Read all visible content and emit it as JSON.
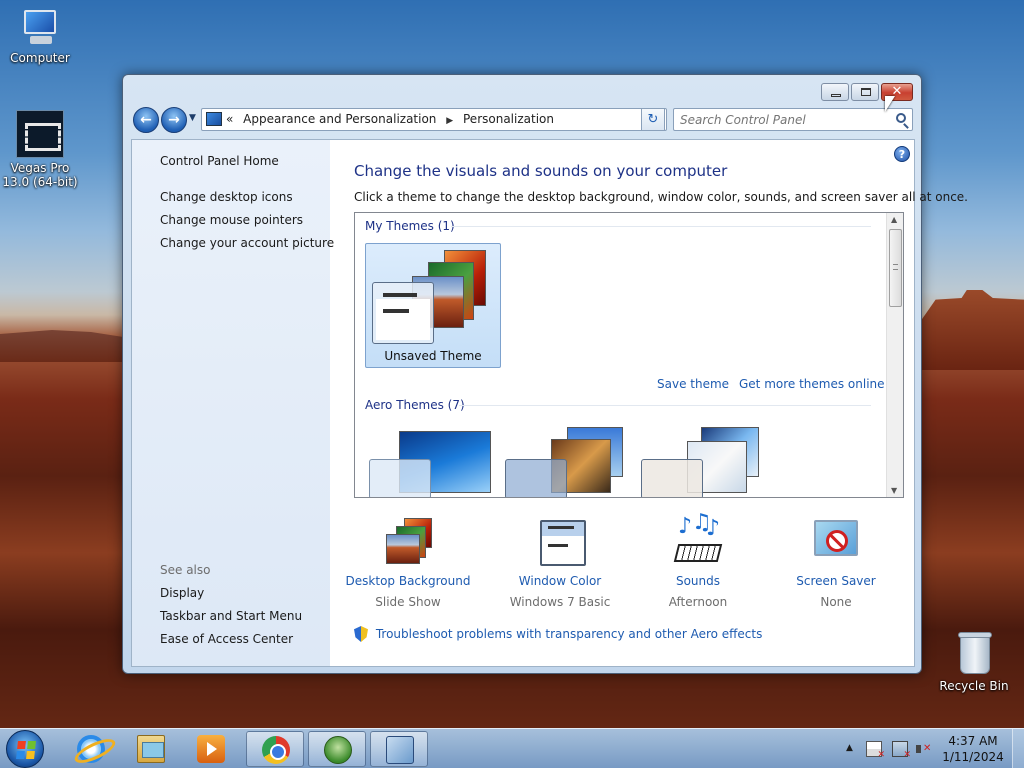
{
  "desktop": {
    "icons": [
      {
        "label": "Computer"
      },
      {
        "label": "Vegas Pro 13.0 (64-bit)"
      },
      {
        "label": "Recycle Bin"
      }
    ]
  },
  "window": {
    "caption_buttons": {
      "minimize": "",
      "maximize": "",
      "close": "✕"
    },
    "nav": {
      "back": "←",
      "forward": "→",
      "recent": "▼",
      "breadcrumb_lead": "«",
      "breadcrumb": [
        "Appearance and Personalization",
        "Personalization"
      ],
      "breadcrumb_sep": "▶",
      "address_dropdown": "▼",
      "refresh": "↻",
      "search_placeholder": "Search Control Panel"
    },
    "sidebar": {
      "home": "Control Panel Home",
      "links": [
        "Change desktop icons",
        "Change mouse pointers",
        "Change your account picture"
      ],
      "see_also_heading": "See also",
      "see_also": [
        "Display",
        "Taskbar and Start Menu",
        "Ease of Access Center"
      ]
    },
    "main": {
      "help": "?",
      "title": "Change the visuals and sounds on your computer",
      "description": "Click a theme to change the desktop background, window color, sounds, and screen saver all at once.",
      "themes": {
        "my_themes_heading": "My Themes (1)",
        "my_themes": [
          {
            "name": "Unsaved Theme"
          }
        ],
        "save_theme": "Save theme",
        "get_more": "Get more themes online",
        "aero_heading": "Aero Themes (7)",
        "scroll_up": "▲",
        "scroll_down": "▼"
      },
      "options": [
        {
          "label": "Desktop Background",
          "value": "Slide Show",
          "icon": "desktop-background-icon"
        },
        {
          "label": "Window Color",
          "value": "Windows 7 Basic",
          "icon": "window-color-icon"
        },
        {
          "label": "Sounds",
          "value": "Afternoon",
          "icon": "sounds-icon"
        },
        {
          "label": "Screen Saver",
          "value": "None",
          "icon": "screen-saver-icon"
        }
      ],
      "troubleshoot": "Troubleshoot problems with transparency and other Aero effects"
    }
  },
  "taskbar": {
    "tray_arrow": "▲",
    "clock_time": "4:37 AM",
    "clock_date": "1/11/2024"
  }
}
